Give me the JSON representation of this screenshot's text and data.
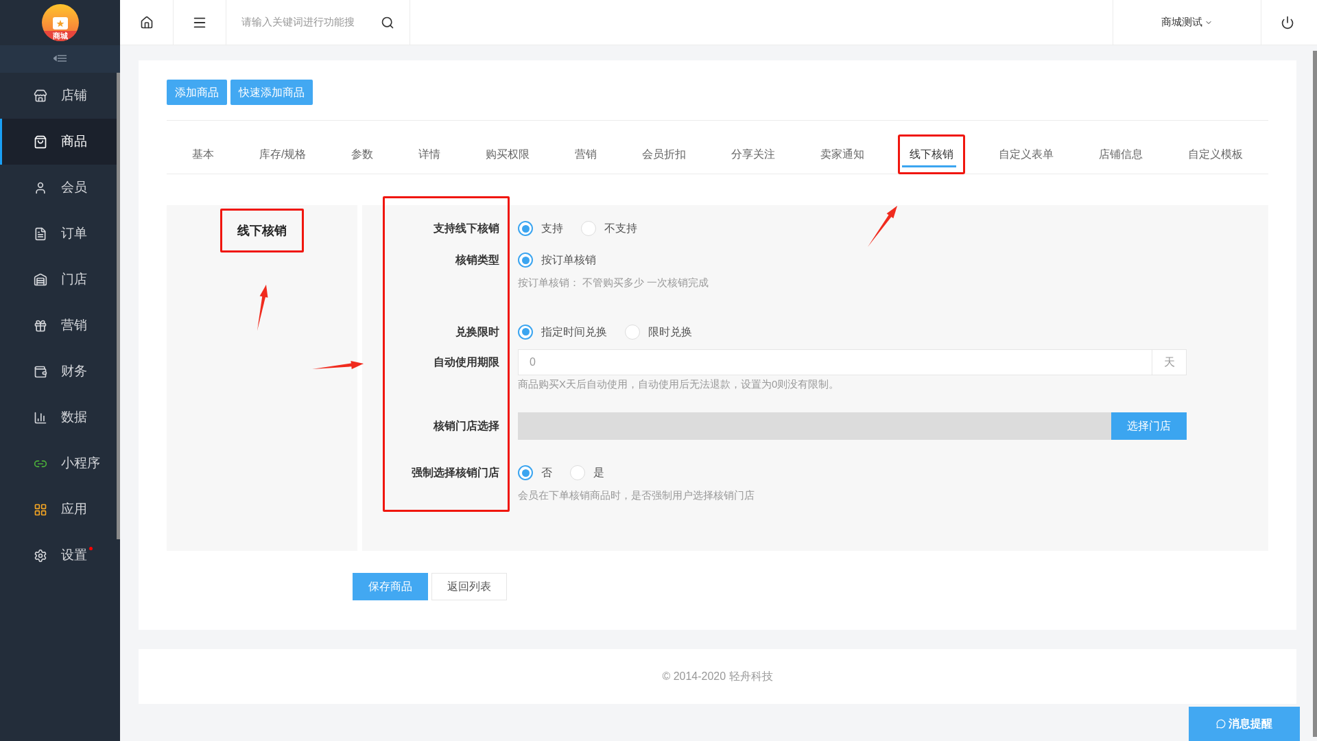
{
  "sidebar": {
    "logo_text": "商城",
    "items": [
      {
        "label": "店铺",
        "selected": false,
        "dot": false
      },
      {
        "label": "商品",
        "selected": true,
        "dot": false
      },
      {
        "label": "会员",
        "selected": false,
        "dot": false
      },
      {
        "label": "订单",
        "selected": false,
        "dot": false
      },
      {
        "label": "门店",
        "selected": false,
        "dot": false
      },
      {
        "label": "营销",
        "selected": false,
        "dot": false
      },
      {
        "label": "财务",
        "selected": false,
        "dot": false
      },
      {
        "label": "数据",
        "selected": false,
        "dot": false
      },
      {
        "label": "小程序",
        "selected": false,
        "dot": false
      },
      {
        "label": "应用",
        "selected": false,
        "dot": false
      },
      {
        "label": "设置",
        "selected": false,
        "dot": true
      }
    ]
  },
  "header": {
    "search": {
      "placeholder": "请输入关键词进行功能搜"
    },
    "user": "商城测试"
  },
  "actions": [
    "添加商品",
    "快速添加商品"
  ],
  "tabs": [
    {
      "label": "基本",
      "selected": false,
      "annotated": false
    },
    {
      "label": "库存/规格",
      "selected": false,
      "annotated": false
    },
    {
      "label": "参数",
      "selected": false,
      "annotated": false
    },
    {
      "label": "详情",
      "selected": false,
      "annotated": false
    },
    {
      "label": "购买权限",
      "selected": false,
      "annotated": false
    },
    {
      "label": "营销",
      "selected": false,
      "annotated": false
    },
    {
      "label": "会员折扣",
      "selected": false,
      "annotated": false
    },
    {
      "label": "分享关注",
      "selected": false,
      "annotated": false
    },
    {
      "label": "卖家通知",
      "selected": false,
      "annotated": false
    },
    {
      "label": "线下核销",
      "selected": true,
      "annotated": true
    },
    {
      "label": "自定义表单",
      "selected": false,
      "annotated": false
    },
    {
      "label": "店铺信息",
      "selected": false,
      "annotated": false
    },
    {
      "label": "自定义模板",
      "selected": false,
      "annotated": false
    }
  ],
  "section": {
    "title": "线下核销",
    "annotated": true
  },
  "form": {
    "labels_annotated": true,
    "rows": [
      {
        "kind": "radio",
        "label": "支持线下核销",
        "options": [
          {
            "label": "支持",
            "selected": true
          },
          {
            "label": "不支持",
            "selected": false
          }
        ]
      },
      {
        "kind": "radio",
        "label": "核销类型",
        "options": [
          {
            "label": "按订单核销",
            "selected": true
          }
        ],
        "hint": "按订单核销：  不管购买多少 一次核销完成"
      },
      {
        "kind": "radio",
        "label": "兑换限时",
        "options": [
          {
            "label": "指定时间兑换",
            "selected": true
          },
          {
            "label": "限时兑换",
            "selected": false
          }
        ]
      },
      {
        "kind": "input",
        "label": "自动使用期限",
        "value": "0",
        "suffix": "天",
        "hint": "商品购买X天后自动使用，自动使用后无法退款，设置为0则没有限制。"
      },
      {
        "kind": "picker",
        "label": "核销门店选择",
        "button": "选择门店"
      },
      {
        "kind": "radio",
        "label": "强制选择核销门店",
        "options": [
          {
            "label": "否",
            "selected": true
          },
          {
            "label": "是",
            "selected": false
          }
        ],
        "hint": "会员在下单核销商品时，是否强制用户选择核销门店"
      }
    ]
  },
  "buttons": {
    "save": "保存商品",
    "back": "返回列表"
  },
  "footer": "© 2014-2020 轻舟科技",
  "message_button": "消息提醒"
}
